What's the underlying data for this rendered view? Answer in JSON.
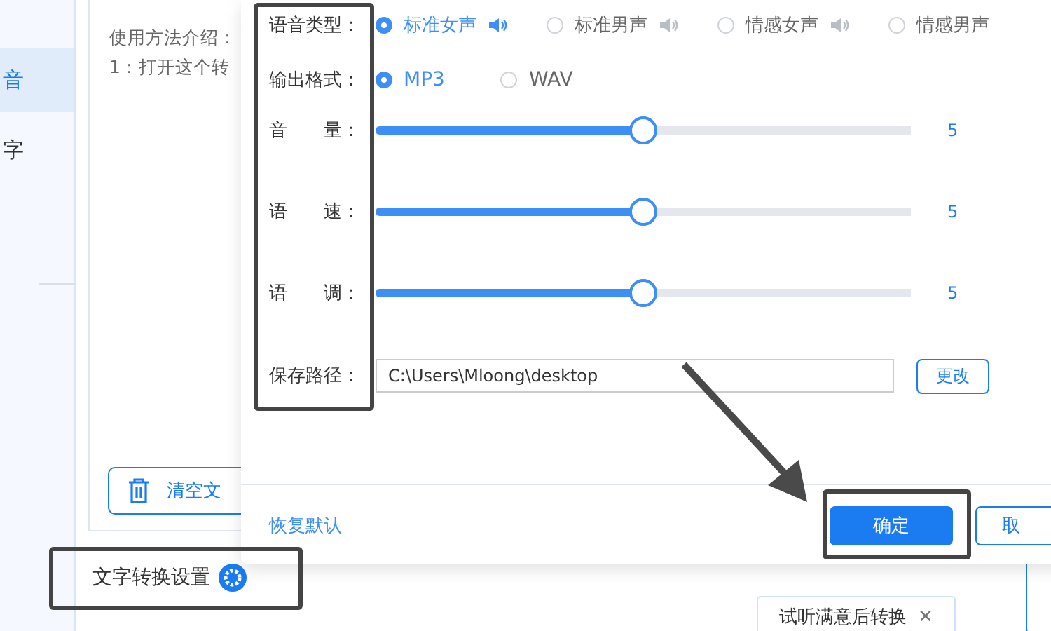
{
  "sidebar": {
    "items": [
      {
        "label": "音",
        "selected": true
      },
      {
        "label": "字",
        "selected": false
      }
    ]
  },
  "intro": {
    "lines": [
      "使用方法介绍：",
      "1：打开这个转"
    ]
  },
  "clear_button": "清空文",
  "settings_link": "文字转换设置",
  "tooltip": {
    "text": "试听满意后转换",
    "close": "✕"
  },
  "dialog": {
    "voice_type": {
      "label": "语音类型：",
      "options": [
        {
          "label": "标准女声",
          "selected": true
        },
        {
          "label": "标准男声",
          "selected": false
        },
        {
          "label": "情感女声",
          "selected": false
        },
        {
          "label": "情感男声",
          "selected": false
        }
      ]
    },
    "output_format": {
      "label": "输出格式：",
      "options": [
        {
          "label": "MP3",
          "selected": true
        },
        {
          "label": "WAV",
          "selected": false
        }
      ]
    },
    "sliders": [
      {
        "label": "音　　量：",
        "level": 0.5,
        "reading": "5"
      },
      {
        "label": "语　　速：",
        "level": 0.5,
        "reading": "5"
      },
      {
        "label": "语　　调：",
        "level": 0.5,
        "reading": "5"
      }
    ],
    "save_path": {
      "label": "保存路径：",
      "value": "C:\\Users\\Mloong\\desktop",
      "button": "更改"
    },
    "reset": "恢复默认",
    "confirm": "确定",
    "cancel": "取"
  }
}
